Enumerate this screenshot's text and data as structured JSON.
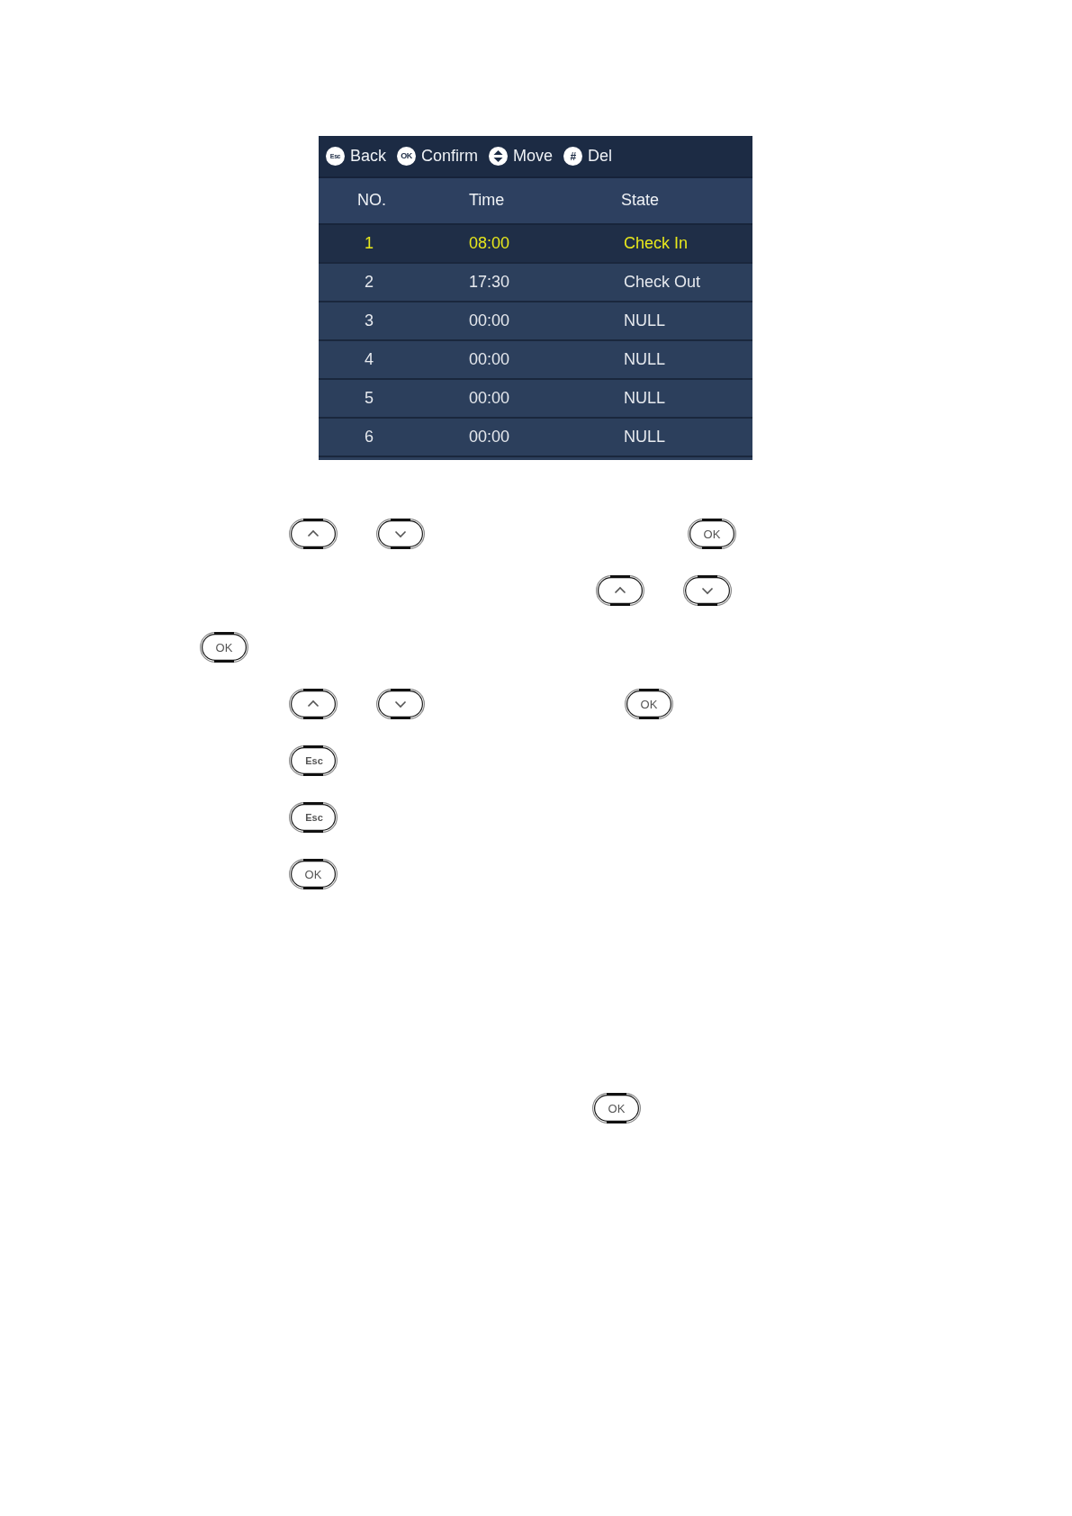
{
  "screen": {
    "toolbar": [
      {
        "kind": "badge",
        "badge": "Esc",
        "label": "Back"
      },
      {
        "kind": "badge",
        "badge": "OK",
        "label": "Confirm"
      },
      {
        "kind": "updown",
        "label": "Move"
      },
      {
        "kind": "badge",
        "badge": "#",
        "label": "Del"
      }
    ],
    "table": {
      "columns": [
        "NO.",
        "Time",
        "State"
      ],
      "rows": [
        {
          "no": "1",
          "time": "08:00",
          "state": "Check In",
          "selected": true
        },
        {
          "no": "2",
          "time": "17:30",
          "state": "Check Out",
          "selected": false
        },
        {
          "no": "3",
          "time": "00:00",
          "state": "NULL",
          "selected": false
        },
        {
          "no": "4",
          "time": "00:00",
          "state": "NULL",
          "selected": false
        },
        {
          "no": "5",
          "time": "00:00",
          "state": "NULL",
          "selected": false
        },
        {
          "no": "6",
          "time": "00:00",
          "state": "NULL",
          "selected": false
        }
      ]
    }
  },
  "key_lines": [
    {
      "keys": [
        {
          "kind": "up"
        },
        {
          "kind": "down"
        },
        {
          "kind": "label",
          "label": "OK"
        }
      ]
    },
    {
      "keys": [
        {
          "kind": "up"
        },
        {
          "kind": "down"
        }
      ]
    },
    {
      "keys": [
        {
          "kind": "label",
          "label": "OK"
        }
      ]
    },
    {
      "keys": [
        {
          "kind": "up"
        },
        {
          "kind": "down"
        },
        {
          "kind": "label",
          "label": "OK"
        }
      ]
    },
    {
      "keys": [
        {
          "kind": "label",
          "label": "Esc"
        }
      ]
    },
    {
      "keys": [
        {
          "kind": "label",
          "label": "Esc"
        }
      ]
    },
    {
      "keys": [
        {
          "kind": "label",
          "label": "OK"
        }
      ]
    },
    {
      "keys": [
        {
          "kind": "label",
          "label": "OK"
        }
      ]
    }
  ]
}
